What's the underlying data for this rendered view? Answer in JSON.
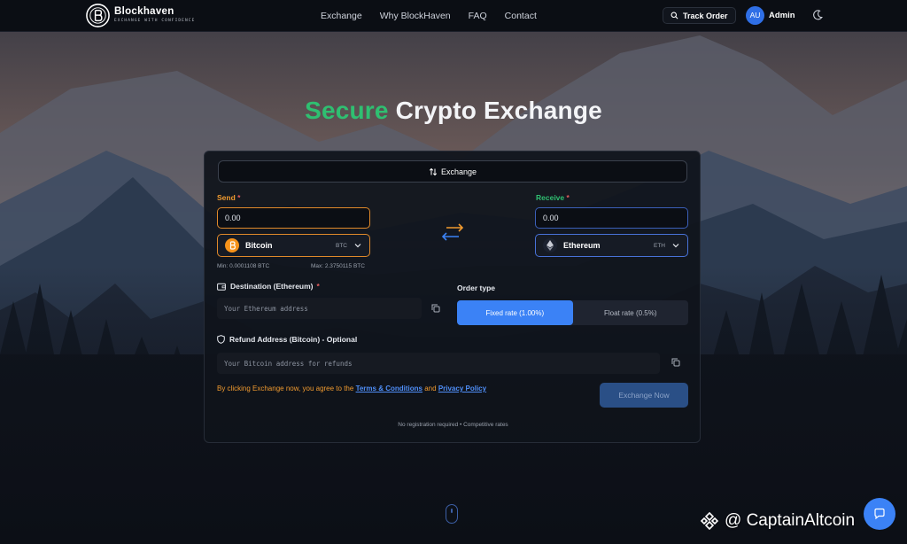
{
  "header": {
    "brand_name": "Blockhaven",
    "brand_tagline": "EXCHANGE WITH CONFIDENCE",
    "nav": [
      "Exchange",
      "Why BlockHaven",
      "FAQ",
      "Contact"
    ],
    "track_order": "Track Order",
    "avatar_initials": "AU",
    "user_name": "Admin"
  },
  "hero": {
    "title_accent": "Secure",
    "title_rest": "Crypto Exchange"
  },
  "form": {
    "tab_label": "Exchange",
    "send": {
      "label": "Send",
      "required_mark": "*",
      "amount": "0.00",
      "coin_name": "Bitcoin",
      "coin_symbol": "BTC",
      "min": "Min: 0.0001108 BTC",
      "max": "Max: 2.3750115 BTC"
    },
    "receive": {
      "label": "Receive",
      "required_mark": "*",
      "amount": "0.00",
      "coin_name": "Ethereum",
      "coin_symbol": "ETH"
    },
    "destination": {
      "label": "Destination (Ethereum)",
      "required_mark": "*",
      "placeholder": "Your Ethereum address"
    },
    "refund": {
      "label": "Refund Address (Bitcoin) - Optional",
      "placeholder": "Your Bitcoin address for refunds"
    },
    "order_type": {
      "label": "Order type",
      "options": [
        "Fixed rate (1.00%)",
        "Float rate (0.5%)"
      ],
      "selected": "Fixed rate (1.00%)"
    },
    "terms": {
      "prefix": "By clicking Exchange now, you agree to the",
      "terms_link": "Terms & Conditions",
      "and": "and",
      "privacy_link": "Privacy Policy"
    },
    "submit_label": "Exchange Now",
    "footnote": "No registration required • Competitive rates"
  },
  "watermark": "@ CaptainAltcoin",
  "colors": {
    "accent_green": "#2fbf71",
    "accent_orange": "#f09a2f",
    "accent_blue": "#3b82f6",
    "background": "#0c0f16"
  }
}
